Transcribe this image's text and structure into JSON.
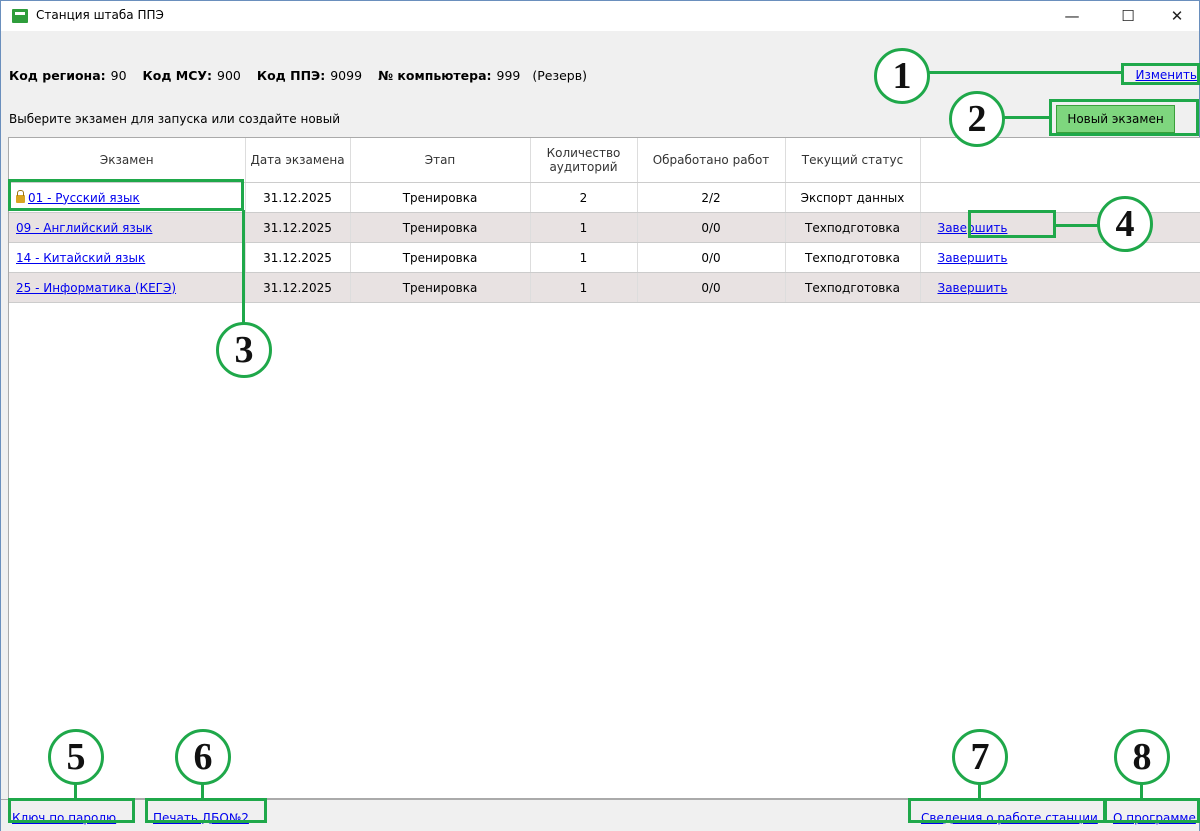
{
  "window": {
    "title": "Станция штаба ППЭ",
    "minimize": "—",
    "maximize": "☐",
    "close": "✕"
  },
  "info": {
    "region_label": "Код региона:",
    "region_value": "90",
    "msu_label": "Код МСУ:",
    "msu_value": "900",
    "ppe_label": "Код ППЭ:",
    "ppe_value": "9099",
    "computer_label": "№ компьютера:",
    "computer_value": "999",
    "reserve": "(Резерв)",
    "change_link": "Изменить"
  },
  "prompt": "Выберите экзамен для запуска или создайте новый",
  "new_exam_button": "Новый экзамен",
  "table": {
    "headers": [
      "Экзамен",
      "Дата экзамена",
      "Этап",
      "Количество аудиторий",
      "Обработано работ",
      "Текущий статус",
      ""
    ],
    "rows": [
      {
        "exam": "01 - Русский язык",
        "date": "31.12.2025",
        "stage": "Тренировка",
        "rooms": "2",
        "processed": "2/2",
        "status": "Экспорт данных",
        "action": "",
        "locked": true
      },
      {
        "exam": "09 - Английский язык",
        "date": "31.12.2025",
        "stage": "Тренировка",
        "rooms": "1",
        "processed": "0/0",
        "status": "Техподготовка",
        "action": "Завершить",
        "locked": false
      },
      {
        "exam": "14 - Китайский язык",
        "date": "31.12.2025",
        "stage": "Тренировка",
        "rooms": "1",
        "processed": "0/0",
        "status": "Техподготовка",
        "action": "Завершить",
        "locked": false
      },
      {
        "exam": "25 - Информатика (КЕГЭ)",
        "date": "31.12.2025",
        "stage": "Тренировка",
        "rooms": "1",
        "processed": "0/0",
        "status": "Техподготовка",
        "action": "Завершить",
        "locked": false
      }
    ]
  },
  "footer": {
    "key_by_password": "Ключ по паролю",
    "print_dbo": "Печать ДБО№2",
    "station_info": "Сведения о работе станции",
    "about": "О программе"
  },
  "callouts": [
    "1",
    "2",
    "3",
    "4",
    "5",
    "6",
    "7",
    "8"
  ],
  "colors": {
    "callout_green": "#1fa84a",
    "button_green": "#7ed67e",
    "link_blue": "#0000ee",
    "alt_row": "#e8e2e2"
  }
}
